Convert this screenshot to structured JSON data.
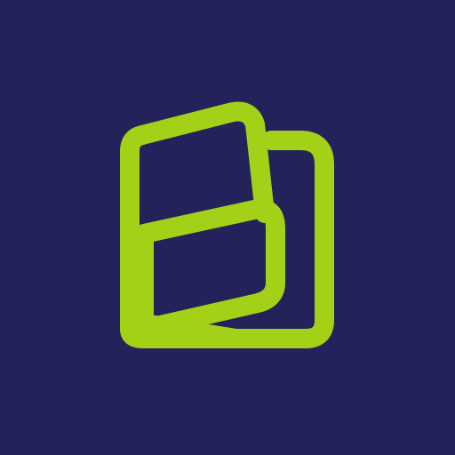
{
  "icon": {
    "name": "book-b-logo",
    "description_role": "app-icon",
    "colors": {
      "background": "#24225a",
      "logo_stroke": "#a3d117"
    }
  }
}
